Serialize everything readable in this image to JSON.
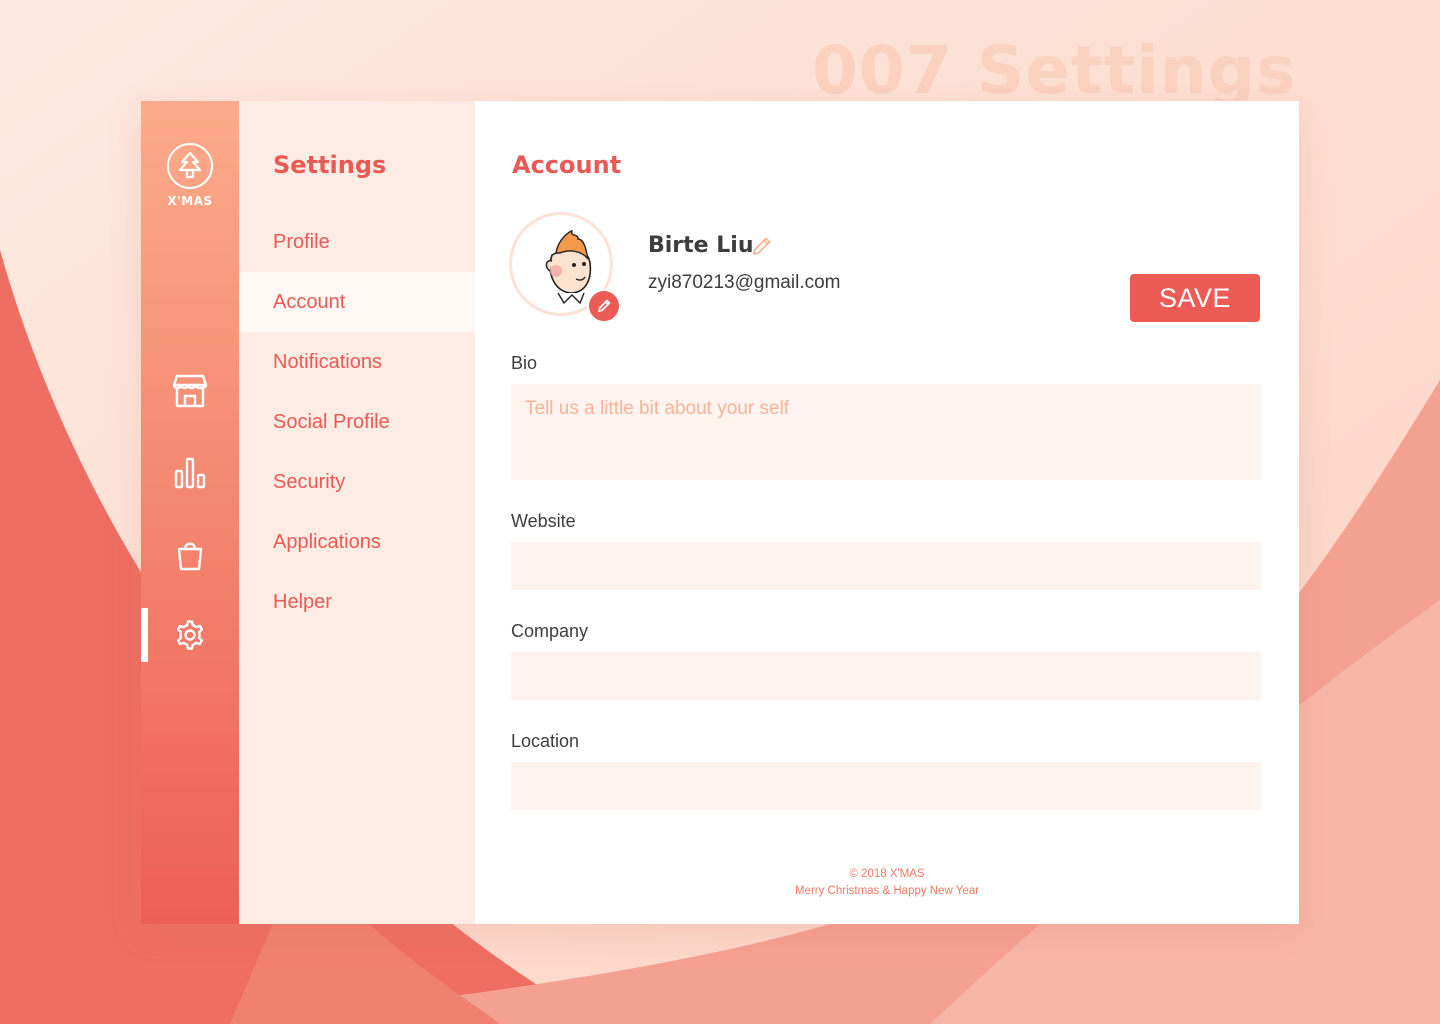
{
  "watermark": "007 Settings",
  "colors": {
    "accent": "#ec5b55",
    "rail_top": "#fcab8a",
    "rail_bottom": "#ee5e57",
    "menu_bg": "#fdece4",
    "input_bg": "#fef3ef",
    "placeholder": "#f8b498"
  },
  "brand": {
    "logo_icon": "tree-icon",
    "logo_text": "X'MAS"
  },
  "rail": {
    "items": [
      {
        "icon": "store-icon"
      },
      {
        "icon": "bar-chart-icon"
      },
      {
        "icon": "shopping-bag-icon"
      },
      {
        "icon": "gear-icon",
        "active": true
      }
    ]
  },
  "menu": {
    "title": "Settings",
    "items": [
      {
        "label": "Profile"
      },
      {
        "label": "Account",
        "active": true
      },
      {
        "label": "Notifications"
      },
      {
        "label": "Social Profile"
      },
      {
        "label": "Security"
      },
      {
        "label": "Applications"
      },
      {
        "label": "Helper"
      }
    ]
  },
  "account": {
    "title": "Account",
    "name": "Birte Liu",
    "email": "zyi870213@gmail.com",
    "save_label": "SAVE"
  },
  "form": {
    "bio": {
      "label": "Bio",
      "value": "",
      "placeholder": "Tell us a little bit about your self"
    },
    "website": {
      "label": "Website",
      "value": "",
      "placeholder": ""
    },
    "company": {
      "label": "Company",
      "value": "",
      "placeholder": ""
    },
    "location": {
      "label": "Location",
      "value": "",
      "placeholder": ""
    }
  },
  "footer": {
    "copyright": "© 2018 X'MAS",
    "tagline": "Merry Christmas & Happy New Year"
  }
}
